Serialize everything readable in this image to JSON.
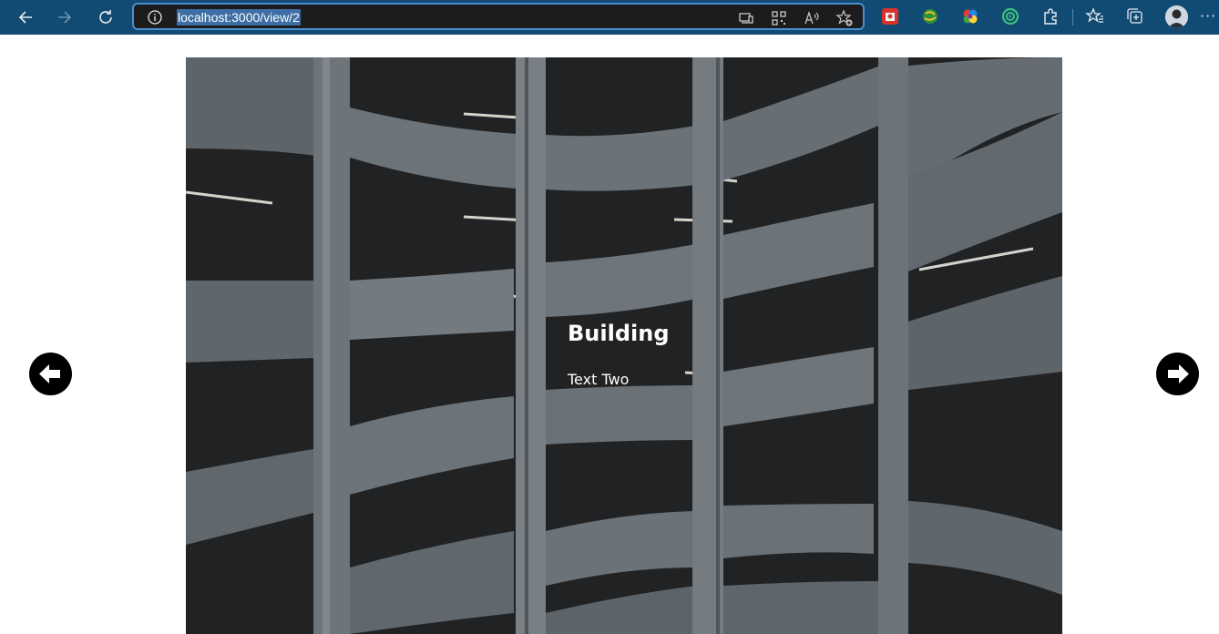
{
  "browser": {
    "url": "localhost:3000/view/2",
    "icons": {
      "back": "arrow-left-icon",
      "forward": "arrow-right-icon",
      "refresh": "refresh-icon",
      "site_info": "info-icon",
      "app_available": "app-available-icon",
      "qr_code": "qr-code-icon",
      "read_aloud": "read-aloud-icon",
      "add_favorite": "star-plus-icon",
      "favorites": "favorites-icon",
      "collections": "collections-icon",
      "extensions": "puzzle-icon",
      "more": "more-icon"
    },
    "colors": {
      "toolbar": "#114a73",
      "address_bar": "#1c1c1c",
      "address_focus": "#4a8fd0",
      "url_highlight": "#3d6ea5"
    },
    "more_label": "···"
  },
  "slider": {
    "slide": {
      "title": "Building",
      "text": "Text Two"
    },
    "prev_icon": "circle-arrow-left-icon",
    "next_icon": "circle-arrow-right-icon"
  }
}
